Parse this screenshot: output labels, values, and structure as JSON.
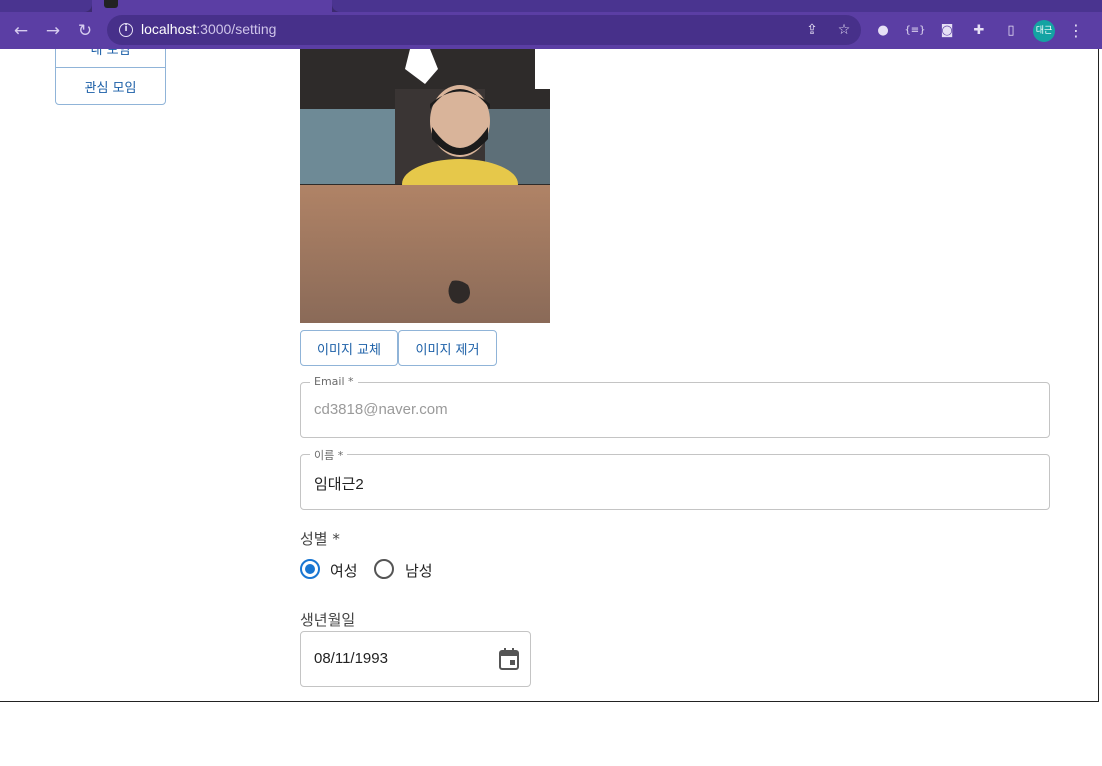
{
  "browser": {
    "url_host": "localhost",
    "url_path": ":3000/setting",
    "profile_initials": "대근"
  },
  "sidebar": {
    "items": [
      {
        "label": "내 모임"
      },
      {
        "label": "관심 모임"
      }
    ]
  },
  "profile_image": {
    "replace_label": "이미지 교체",
    "remove_label": "이미지 제거"
  },
  "form": {
    "email": {
      "label": "Email *",
      "value": "cd3818@naver.com",
      "disabled": true
    },
    "name": {
      "label": "이름 *",
      "value": "임대근2"
    },
    "gender": {
      "label": "성별 *",
      "options": [
        {
          "label": "여성",
          "checked": true
        },
        {
          "label": "남성",
          "checked": false
        }
      ]
    },
    "birthdate": {
      "label": "생년월일",
      "value": "08/11/1993"
    }
  },
  "colors": {
    "accent": "#1976d2",
    "link": "#1b5fa7",
    "browser_frame": "#5b3ea4"
  }
}
